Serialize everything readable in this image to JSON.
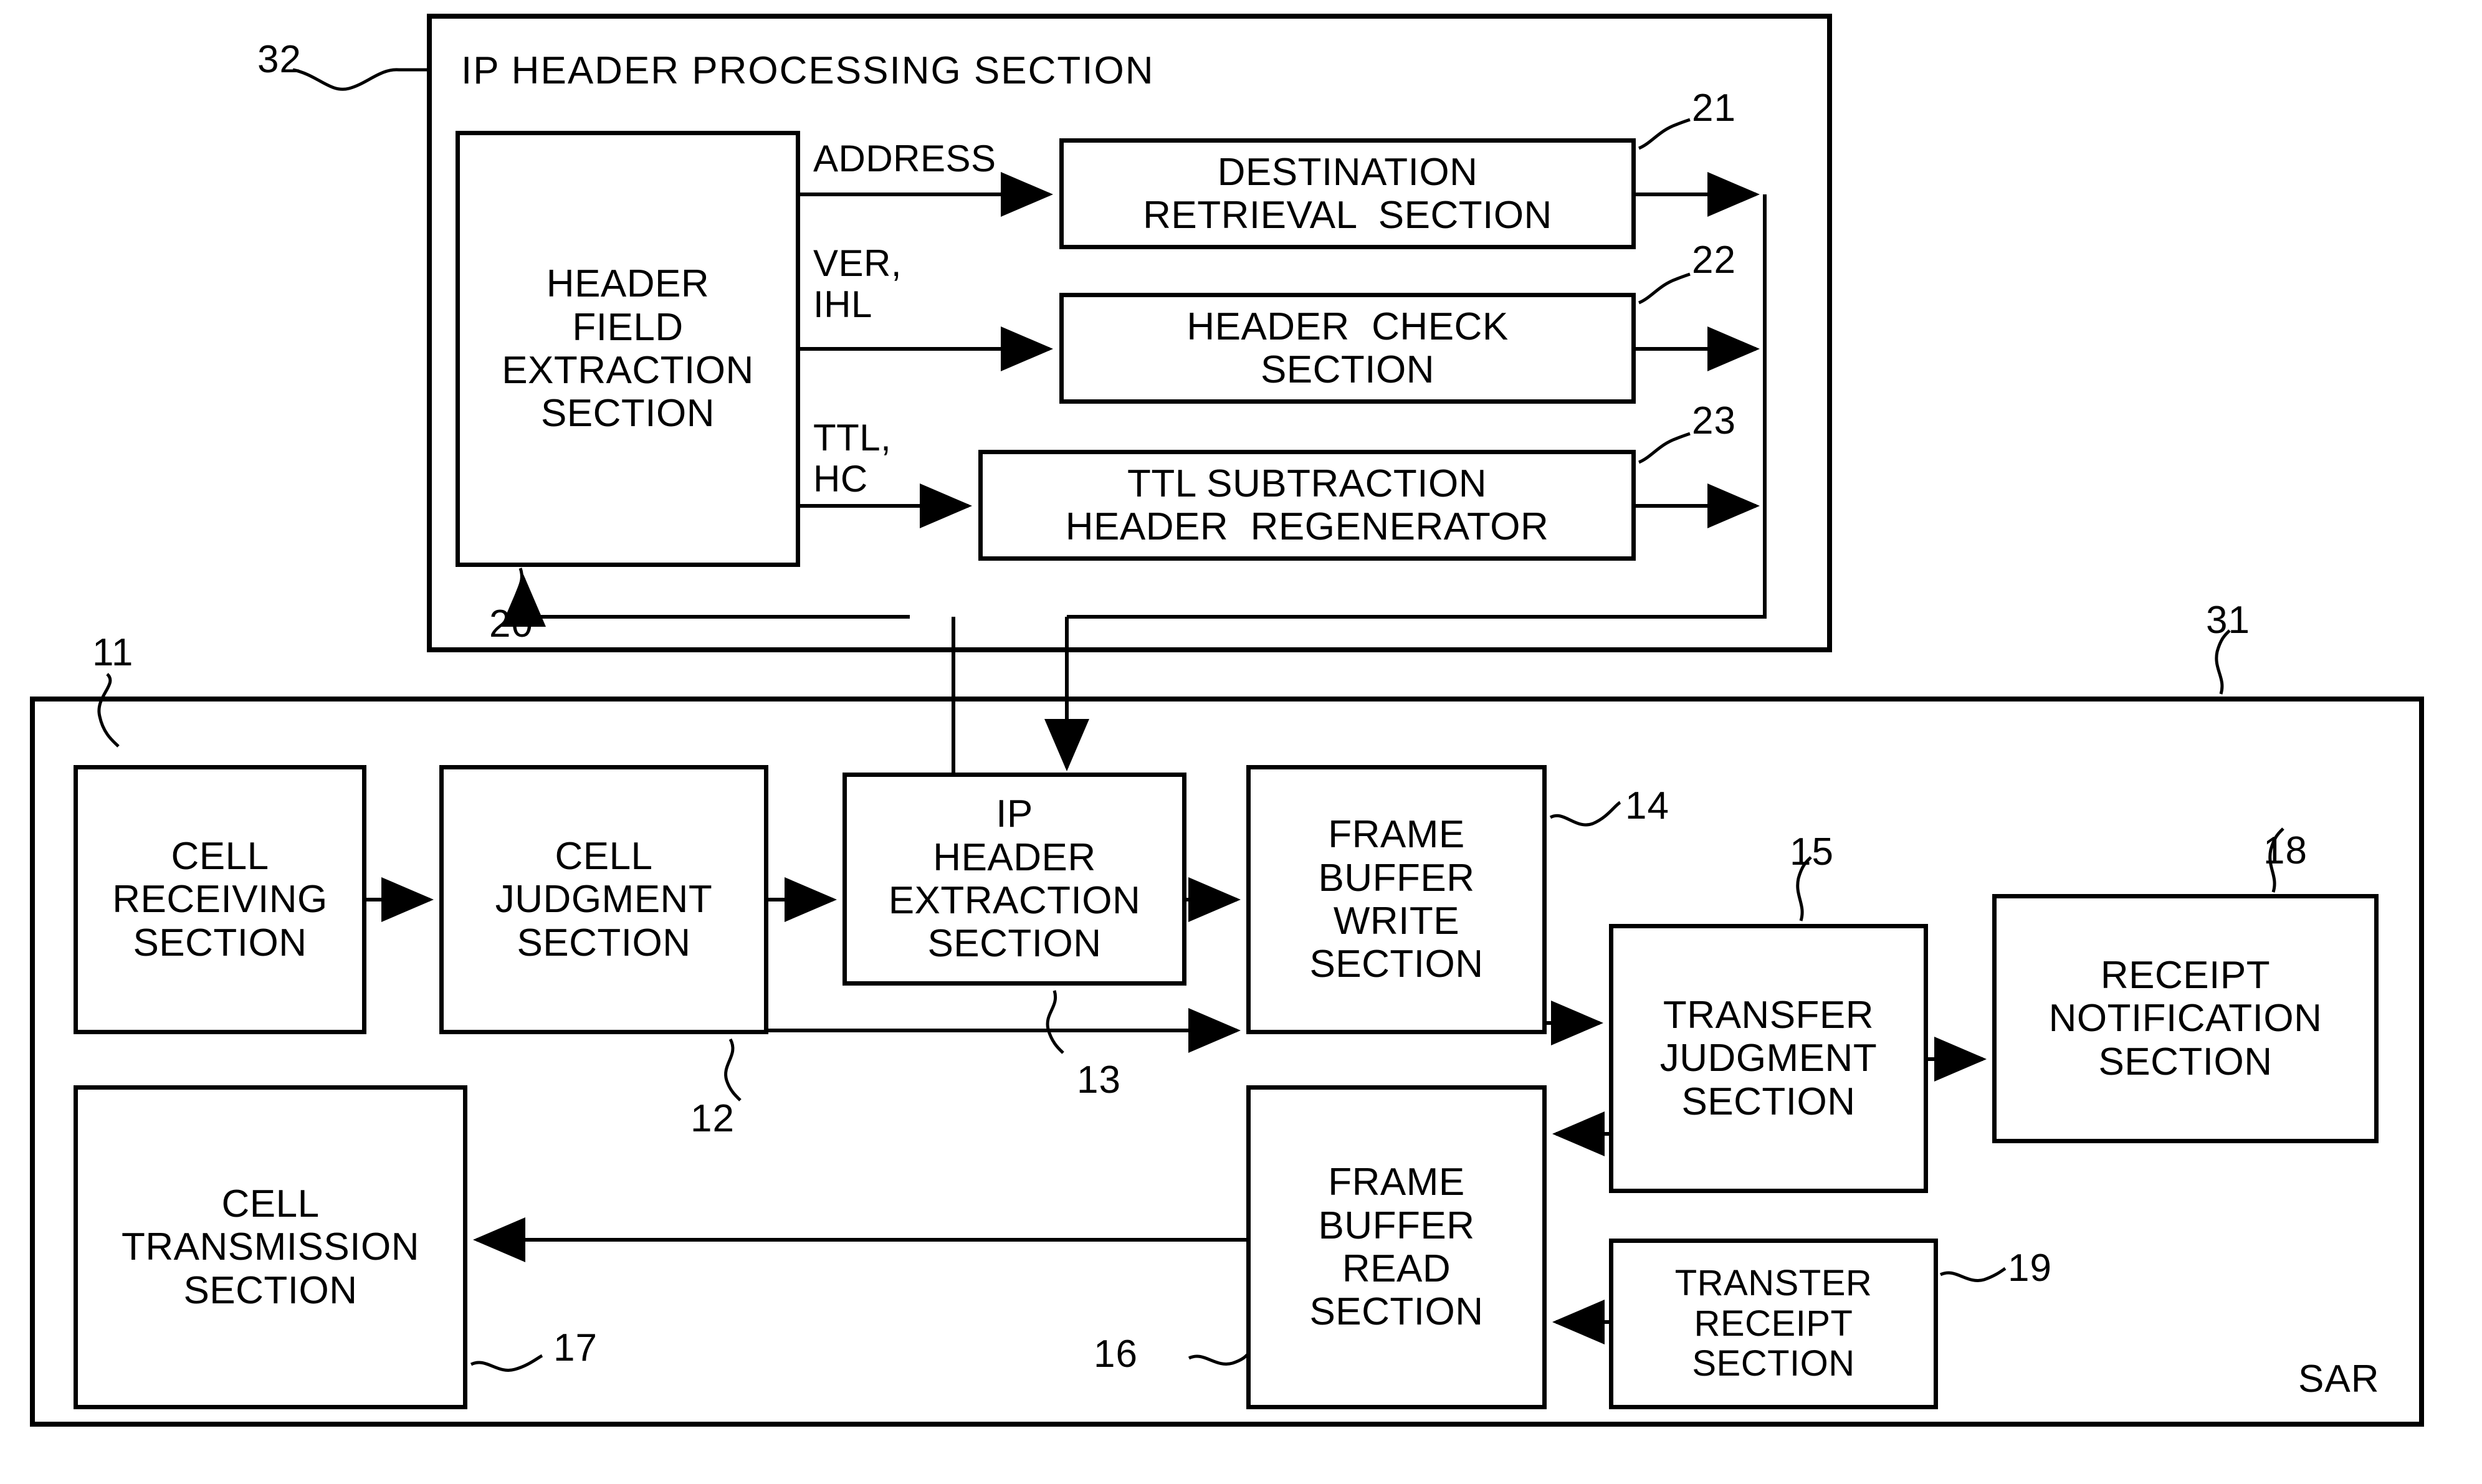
{
  "diagram": {
    "top_section": {
      "title": "IP HEADER PROCESSING SECTION",
      "ref": "32",
      "blocks": [
        {
          "id": "header-field-extraction",
          "label": "HEADER\nFIELD\nEXTRACTION\nSECTION",
          "ref": "20"
        },
        {
          "id": "destination-retrieval",
          "label": "DESTINATION\nRETRIEVAL  SECTION",
          "ref": "21"
        },
        {
          "id": "header-check",
          "label": "HEADER  CHECK\nSECTION",
          "ref": "22"
        },
        {
          "id": "ttl-subtraction-header-regenerator",
          "label": "TTL SUBTRACTION\nHEADER  REGENERATOR",
          "ref": "23"
        }
      ],
      "signals": [
        {
          "id": "address",
          "label": "ADDRESS"
        },
        {
          "id": "ver-ihl",
          "label": "VER,\nIHL"
        },
        {
          "id": "ttl-hc",
          "label": "TTL,\nHC"
        }
      ]
    },
    "bottom_section": {
      "title": "SAR",
      "ref": "31",
      "blocks": [
        {
          "id": "cell-receiving",
          "label": "CELL\nRECEIVING\nSECTION",
          "ref": "11"
        },
        {
          "id": "cell-judgment",
          "label": "CELL\nJUDGMENT\nSECTION",
          "ref": "12"
        },
        {
          "id": "ip-header-extraction",
          "label": "IP\nHEADER\nEXTRACTION\nSECTION",
          "ref": "13"
        },
        {
          "id": "frame-buffer-write",
          "label": "FRAME\nBUFFER\nWRITE\nSECTION",
          "ref": "14"
        },
        {
          "id": "transfer-judgment",
          "label": "TRANSFER\nJUDGMENT\nSECTION",
          "ref": "15"
        },
        {
          "id": "receipt-notification",
          "label": "RECEIPT\nNOTIFICATION\nSECTION",
          "ref": "18"
        },
        {
          "id": "frame-buffer-read",
          "label": "FRAME\nBUFFER\nREAD\nSECTION",
          "ref": "16"
        },
        {
          "id": "transter-receipt",
          "label": "TRANSTER\nRECEIPT\nSECTION",
          "ref": "19"
        },
        {
          "id": "cell-transmission",
          "label": "CELL\nTRANSMISSION\nSECTION",
          "ref": "17"
        }
      ]
    },
    "colors": {
      "line": "#000000",
      "background": "#ffffff"
    }
  }
}
